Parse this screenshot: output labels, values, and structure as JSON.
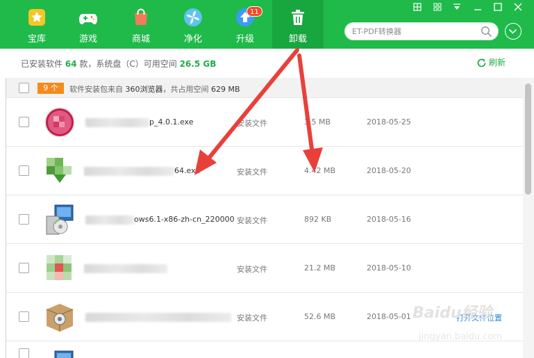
{
  "tabs": [
    {
      "label": "宝库",
      "icon": "treasure-star-icon"
    },
    {
      "label": "游戏",
      "icon": "gamepad-icon"
    },
    {
      "label": "商城",
      "icon": "shopping-bag-icon"
    },
    {
      "label": "净化",
      "icon": "purify-fan-icon"
    },
    {
      "label": "升级",
      "icon": "upgrade-arrow-icon",
      "badge": "11"
    },
    {
      "label": "卸载",
      "icon": "trash-icon",
      "active": true
    }
  ],
  "search": {
    "placeholder": "ET-PDF转换器"
  },
  "window_controls": [
    "skin",
    "menu",
    "dropdown",
    "minimize",
    "maximize",
    "close"
  ],
  "info": {
    "installed_prefix": "已安装软件",
    "installed_count": "64",
    "installed_mid": "款，系统盘（C）可用空间",
    "free_space": "26.5 GB"
  },
  "refresh_label": "刷新",
  "group": {
    "count_label": "9 个",
    "text_prefix": "软件安装包来自",
    "source": "360浏览器",
    "text_mid": "，共占用空间",
    "total": "629 MB"
  },
  "rows": [
    {
      "name": "p_4.0.1.exe",
      "type": "安装文件",
      "size": "3.5 MB",
      "date": "2018-05-25",
      "icon": "pink-ball-app-icon"
    },
    {
      "name": "64.exe",
      "type": "安装文件",
      "size": "4.42 MB",
      "date": "2018-05-20",
      "icon": "green-download-app-icon"
    },
    {
      "name": "ows6.1-x86-zh-cn_220000",
      "type": "安装文件",
      "size": "892 KB",
      "date": "2018-05-16",
      "icon": "installer-cd-icon"
    },
    {
      "name": "",
      "type": "安装文件",
      "size": "21.2 MB",
      "date": "2018-05-10",
      "icon": "pixelated-app-icon"
    },
    {
      "name": "",
      "type": "安装文件",
      "size": "52.6 MB",
      "date": "2018-05-01",
      "icon": "package-box-icon",
      "action": "打开文件位置"
    }
  ],
  "watermark": {
    "text": "Baidu经验",
    "sub": "jingyan.baidu.com"
  },
  "colors": {
    "brand_green": "#1fba4a",
    "badge_orange": "#f48b1d",
    "badge_red": "#f04a2b",
    "arrow_red": "#e8403a"
  }
}
